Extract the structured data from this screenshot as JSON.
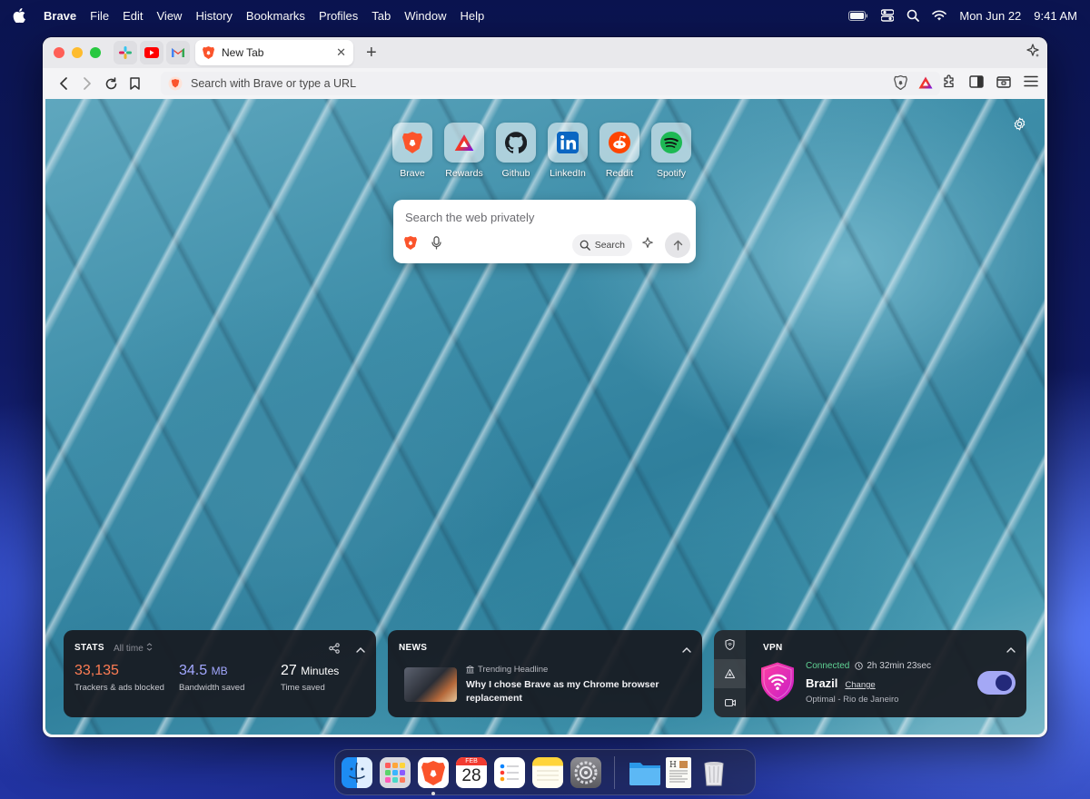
{
  "menubar": {
    "app_name": "Brave",
    "items": [
      "File",
      "Edit",
      "View",
      "History",
      "Bookmarks",
      "Profiles",
      "Tab",
      "Window",
      "Help"
    ],
    "date": "Mon Jun 22",
    "time": "9:41 AM"
  },
  "tabs": {
    "pinned": [
      "slack",
      "youtube",
      "gmail"
    ],
    "active_title": "New Tab"
  },
  "toolbar": {
    "omnibox_placeholder": "Search with Brave or type a URL"
  },
  "topsites": [
    {
      "label": "Brave",
      "icon": "brave-lion-icon"
    },
    {
      "label": "Rewards",
      "icon": "rewards-triangle-icon"
    },
    {
      "label": "Github",
      "icon": "github-icon"
    },
    {
      "label": "LinkedIn",
      "icon": "linkedin-icon"
    },
    {
      "label": "Reddit",
      "icon": "reddit-icon"
    },
    {
      "label": "Spotify",
      "icon": "spotify-icon"
    }
  ],
  "search": {
    "placeholder": "Search the web privately",
    "search_button": "Search"
  },
  "stats": {
    "header": "STATS",
    "range": "All time",
    "trackers_value": "33,135",
    "trackers_label": "Trackers & ads blocked",
    "bandwidth_value": "34.5",
    "bandwidth_unit": "MB",
    "bandwidth_label": "Bandwidth saved",
    "time_value": "27",
    "time_unit": "Minutes",
    "time_label": "Time saved"
  },
  "news": {
    "header": "NEWS",
    "kicker": "Trending Headline",
    "headline": "Why I chose Brave as my Chrome browser replacement"
  },
  "vpn": {
    "header": "VPN",
    "status": "Connected",
    "duration": "2h 32min 23sec",
    "country": "Brazil",
    "change_label": "Change",
    "server": "Optimal - Rio de Janeiro",
    "enabled": true
  },
  "dock": {
    "apps": [
      "finder-icon",
      "launchpad-icon",
      "brave-icon",
      "calendar-icon",
      "reminders-icon",
      "notes-icon",
      "settings-icon",
      "folder-icon",
      "document-icon",
      "trash-icon"
    ],
    "calendar_month": "FEB",
    "calendar_day": "28"
  },
  "colors": {
    "brave_orange": "#fb542b",
    "stats_orange": "#ff7d54",
    "stats_purple": "#a3a8ff",
    "vpn_connected": "#60d394",
    "vpn_toggle": "#a4a8f5"
  }
}
